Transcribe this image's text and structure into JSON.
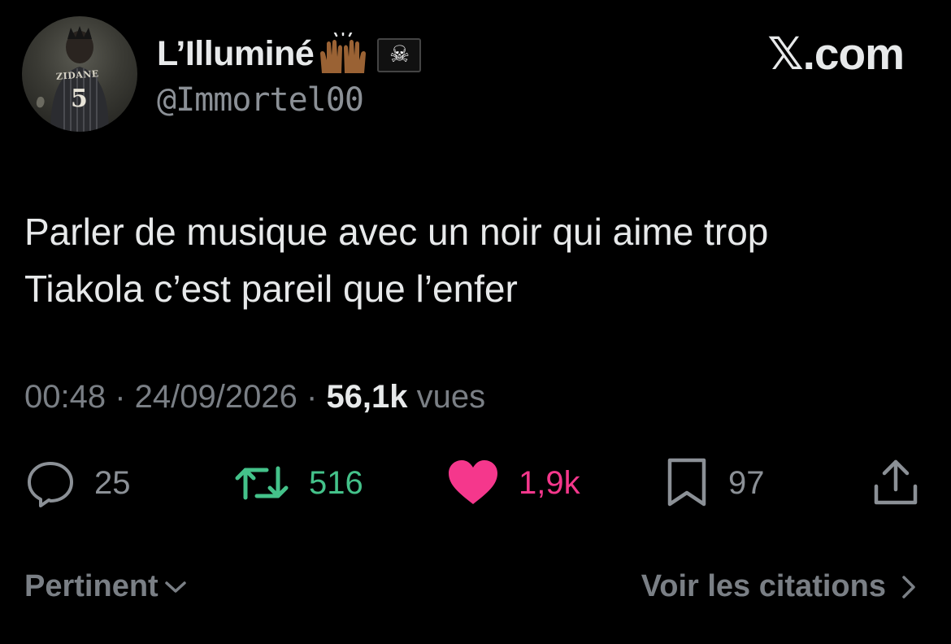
{
  "author": {
    "display_name": "L’Illuminé",
    "handle": "@Immortel00",
    "avatar_text": "ZIDANE",
    "avatar_number": "5"
  },
  "brand": "𝕏.com",
  "tweet": {
    "text": "Parler de musique avec un noir qui aime trop\nTiakola c’est pareil que l’enfer",
    "time": "00:48",
    "date": "24/09/2026",
    "views_count": "56,1k",
    "views_label": "vues"
  },
  "actions": {
    "replies": "25",
    "retweets": "516",
    "likes": "1,9k",
    "bookmarks": "97"
  },
  "footer": {
    "sort_label": "Pertinent",
    "quotes_label": "Voir les citations"
  },
  "colors": {
    "background": "#000000",
    "retweet": "#44c28a",
    "like": "#f5378c",
    "muted": "#7a7f85"
  }
}
